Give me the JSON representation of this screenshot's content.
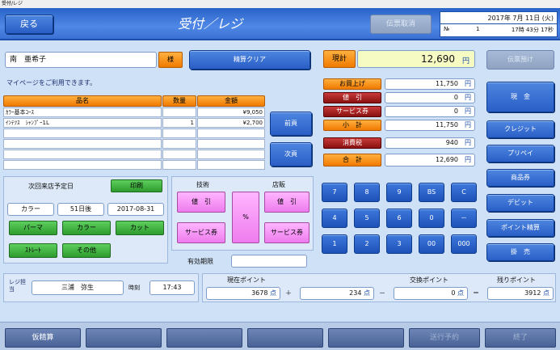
{
  "window": {
    "title": "受付/レジ"
  },
  "header": {
    "back_label": "戻る",
    "title": "受付／レジ",
    "cancel_slip_label": "伝票取消",
    "date": "2017年 7月 11日 (火)",
    "no_label": "№",
    "no_value": "1",
    "time": "17時 43分 17秒"
  },
  "customer": {
    "name": "南　亜希子",
    "honorific": "様",
    "clear_label": "精算クリア",
    "mypage_text": "マイページをご利用できます。"
  },
  "items_table": {
    "headers": [
      "品名",
      "数量",
      "金額"
    ],
    "rows": [
      {
        "name": "ｶﾗｰ基本ｺｰｽ",
        "qty": "",
        "amount": "¥9,050"
      },
      {
        "name": "ｲﾝﾃﾂｽ　ｼｬﾝﾌﾟｰ1L",
        "qty": "1",
        "amount": "¥2,700"
      },
      {
        "name": "",
        "qty": "",
        "amount": ""
      },
      {
        "name": "",
        "qty": "",
        "amount": ""
      },
      {
        "name": "",
        "qty": "",
        "amount": ""
      },
      {
        "name": "",
        "qty": "",
        "amount": ""
      }
    ],
    "prev_label": "前頁",
    "next_label": "次頁"
  },
  "next_visit": {
    "title": "次回来店予定日",
    "print_label": "印刷",
    "category": "カラー",
    "interval": "51日後",
    "date": "2017-08-31",
    "menu_buttons": [
      "パーマ",
      "カラー",
      "カット",
      "ｽﾄﾚｰﾄ",
      "その他"
    ]
  },
  "discount": {
    "tech_label": "技術",
    "shop_label": "店販",
    "tech_discount": "値　引",
    "tech_voucher": "サービス券",
    "percent": "%",
    "shop_discount": "値　引",
    "shop_voucher": "サービス券",
    "expiry_label": "有効期限",
    "expiry_value": ""
  },
  "summary": {
    "total_label": "現計",
    "total_value": "12,690",
    "yen": "円",
    "rows": [
      {
        "label": "お買上げ",
        "value": "11,750",
        "style": "orange"
      },
      {
        "label": "値　引",
        "value": "0",
        "style": "red"
      },
      {
        "label": "サービス券",
        "value": "0",
        "style": "red"
      },
      {
        "label": "小　計",
        "value": "11,750",
        "style": "orange"
      },
      {
        "label": "消費税",
        "value": "940",
        "style": "red"
      },
      {
        "label": "合　計",
        "value": "12,690",
        "style": "orange"
      }
    ]
  },
  "keypad": {
    "keys": [
      "7",
      "8",
      "9",
      "BS",
      "C",
      "4",
      "5",
      "6",
      "0",
      "－",
      "1",
      "2",
      "3",
      "00",
      "000"
    ]
  },
  "payment": {
    "buttons": [
      "伝票預け",
      "現　金",
      "クレジット",
      "プリペイ",
      "商品券",
      "デビット",
      "ポイント精算",
      "掛　売"
    ]
  },
  "staff": {
    "label": "レジ担当",
    "name": "三浦　弥生",
    "time_label": "時刻",
    "time": "17:43"
  },
  "points": {
    "current_label": "現在ポイント",
    "current": "3678",
    "unit": "点",
    "plus": "＋",
    "added": "234",
    "minus": "－",
    "exchange_label": "交換ポイント",
    "exchange": "0",
    "equals": "＝",
    "remaining_label": "残りポイント",
    "remaining": "3912"
  },
  "footer": {
    "buttons": [
      "仮精算",
      "",
      "",
      "",
      "",
      "送行予約",
      "終了"
    ]
  },
  "colors": {
    "header_blue": "#2a63c8",
    "background": "#cfe1f7",
    "orange": "#f07a00",
    "green": "#2d9b2d",
    "pink": "#ee7bee",
    "red": "#8a1010",
    "total_yellow": "#f6fbc4"
  }
}
